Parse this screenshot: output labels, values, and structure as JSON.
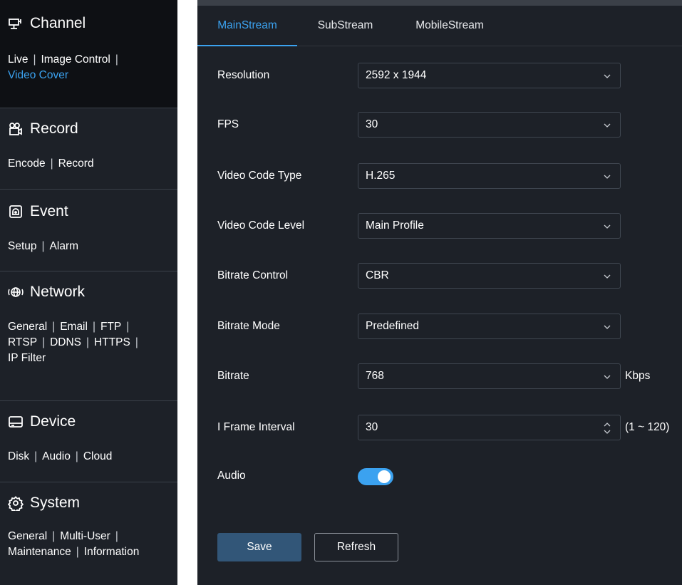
{
  "sidebar": {
    "channel": {
      "title": "Channel",
      "links": [
        "Live",
        "Image Control",
        "Video Cover"
      ],
      "current": "Video Cover"
    },
    "record": {
      "title": "Record",
      "links": [
        "Encode",
        "Record"
      ]
    },
    "event": {
      "title": "Event",
      "links": [
        "Setup",
        "Alarm"
      ]
    },
    "network": {
      "title": "Network",
      "links": [
        "General",
        "Email",
        "FTP",
        "RTSP",
        "DDNS",
        "HTTPS",
        "IP Filter"
      ]
    },
    "device": {
      "title": "Device",
      "links": [
        "Disk",
        "Audio",
        "Cloud"
      ]
    },
    "system": {
      "title": "System",
      "links": [
        "General",
        "Multi-User",
        "Maintenance",
        "Information"
      ]
    },
    "icons": [
      "channel-icon",
      "record-icon",
      "event-icon",
      "network-icon",
      "device-icon",
      "system-icon"
    ]
  },
  "tabs": [
    "MainStream",
    "SubStream",
    "MobileStream"
  ],
  "active_tab": "MainStream",
  "form": {
    "resolution": {
      "label": "Resolution",
      "value": "2592 x 1944"
    },
    "fps": {
      "label": "FPS",
      "value": "30"
    },
    "video_code_type": {
      "label": "Video Code Type",
      "value": "H.265"
    },
    "video_code_level": {
      "label": "Video Code Level",
      "value": "Main Profile"
    },
    "bitrate_control": {
      "label": "Bitrate Control",
      "value": "CBR"
    },
    "bitrate_mode": {
      "label": "Bitrate Mode",
      "value": "Predefined"
    },
    "bitrate": {
      "label": "Bitrate",
      "value": "768",
      "unit": "Kbps"
    },
    "i_frame_interval": {
      "label": "I Frame Interval",
      "value": "30",
      "range": "(1 ~ 120)"
    },
    "audio": {
      "label": "Audio",
      "enabled": true
    }
  },
  "buttons": {
    "save": "Save",
    "refresh": "Refresh"
  },
  "colors": {
    "accent": "#3ba2f0",
    "panel": "#1d2128",
    "save_button": "#325678"
  }
}
